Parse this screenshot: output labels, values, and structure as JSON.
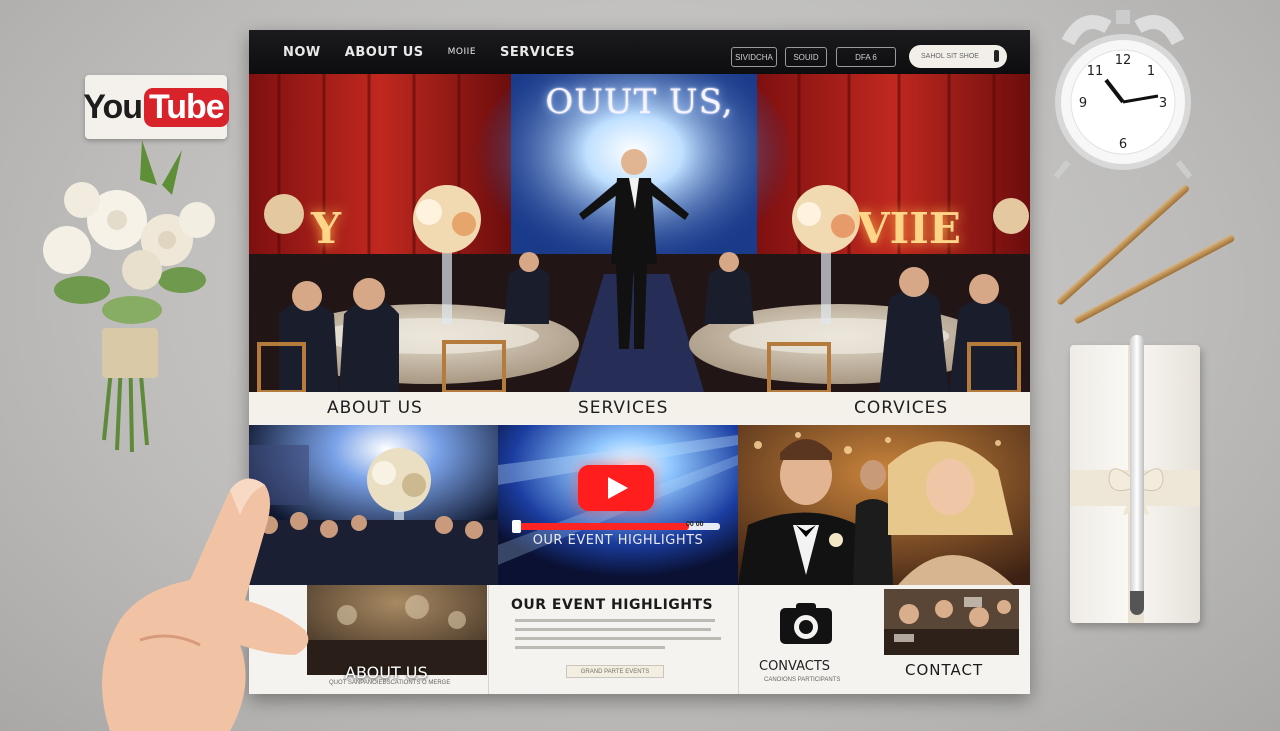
{
  "desk": {
    "youtube_logo": {
      "you": "You",
      "tube": "Tube"
    }
  },
  "site": {
    "nav": {
      "links": [
        "NOW",
        "ABOUT US",
        "MOIIE",
        "SERVICES"
      ],
      "pills": [
        "SIVIDCHA",
        "SOUID",
        "DFA 6"
      ],
      "search_placeholder": "SAHOL SIT SHOE"
    },
    "hero": {
      "title": "OUUT US,",
      "marquee_left": "Y",
      "marquee_right": "VIIE"
    },
    "section_bar": [
      "ABOUT US",
      "SERVICES",
      "CORVICES"
    ],
    "video_tile": {
      "caption": "OUR EVENT HIGHLIGHTS",
      "progress": 0.85,
      "time": "00 00"
    },
    "bottom": {
      "about_label": "ABOUT US",
      "about_sub": "QUOT SANPANOIEBSCATIONTS O MERGE",
      "highlights_title": "OUR EVENT HIGHLIGHTS",
      "highlights_button": "GRAND PARTE EVENTS",
      "contacts_label": "CONVACTS",
      "contacts_sub": "CANOIONS PARTICIPANTS",
      "contact_label": "CONTACT"
    },
    "colors": {
      "nav_bg": "#111113",
      "accent_red": "#ff1d1d",
      "paper": "#f5f3ef"
    }
  }
}
